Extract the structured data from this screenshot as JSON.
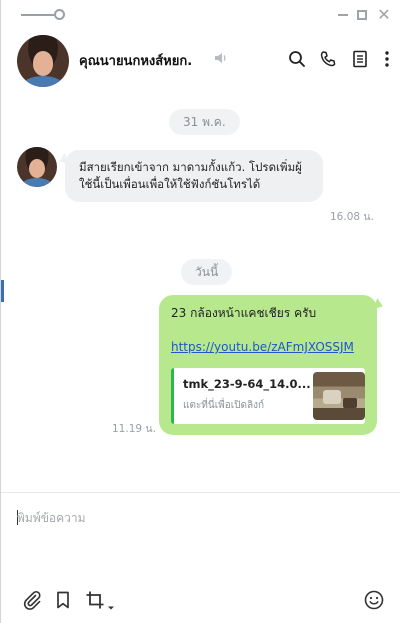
{
  "window": {
    "controls": {
      "minimize_icon": "minimize-icon",
      "maximize_icon": "maximize-icon",
      "close_icon": "close-icon",
      "close_glyph": "✕"
    }
  },
  "header": {
    "contact_name": "คุณนายนกหงส์หยก.",
    "icons": [
      "speaker-icon",
      "search-icon",
      "phone-icon",
      "note-icon",
      "more-icon"
    ]
  },
  "chat": {
    "date_separators": [
      "31 พ.ค.",
      "วันนี้"
    ],
    "messages": [
      {
        "direction": "incoming",
        "text": "มีสายเรียกเข้าจาก มาดามกั้งแก้ว. โปรดเพิ่มผู้ใช้นี้เป็นเพื่อนเพื่อให้ใช้ฟังก์ชันโทรได้",
        "time": "16.08 น."
      },
      {
        "direction": "outgoing",
        "text": "23 กล้องหน้าแคชเชียร ครับ",
        "link": "https://youtu.be/zAFmJXOSSJM",
        "preview": {
          "title": "tmk_23-9-64_14.0...",
          "subtitle": "แตะที่นี่เพื่อเปิดลิงก์"
        },
        "time": "11.19 น."
      }
    ]
  },
  "composer": {
    "placeholder": "พิมพ์ข้อความ",
    "value": "",
    "tools": [
      "attach-icon",
      "bookmark-icon",
      "crop-icon",
      "emoji-icon"
    ]
  },
  "colors": {
    "outgoing_bubble": "#b7e88e",
    "incoming_bubble": "#eef0f2",
    "link": "#1d57c9",
    "preview_accent": "#2db84d"
  }
}
